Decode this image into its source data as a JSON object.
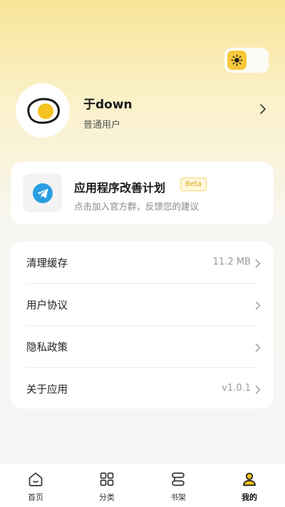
{
  "theme_toggle": {
    "icon": "sun-icon",
    "accent": "#f7c83a"
  },
  "profile": {
    "name": "于down",
    "type": "普通用户",
    "avatar_icon": "egg-avatar-icon"
  },
  "improvement": {
    "title": "应用程序改善计划",
    "badge": "Beta",
    "subtitle": "点击加入官方群，反馈您的建议",
    "icon": "telegram-icon"
  },
  "settings": {
    "items": [
      {
        "label": "清理缓存",
        "value": "11.2 MB"
      },
      {
        "label": "用户协议",
        "value": ""
      },
      {
        "label": "隐私政策",
        "value": ""
      },
      {
        "label": "关于应用",
        "value": "v1.0.1"
      }
    ]
  },
  "tabbar": {
    "tabs": [
      {
        "label": "首页",
        "icon": "home-icon"
      },
      {
        "label": "分类",
        "icon": "grid-icon"
      },
      {
        "label": "书架",
        "icon": "bookshelf-icon"
      },
      {
        "label": "我的",
        "icon": "user-icon",
        "active": true
      }
    ]
  }
}
